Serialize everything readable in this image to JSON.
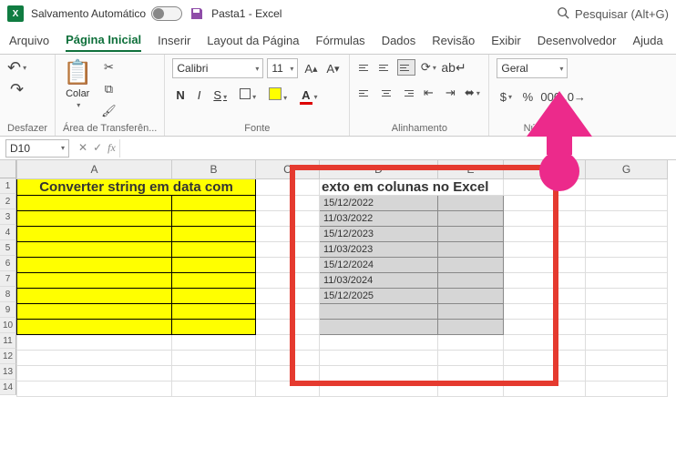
{
  "titlebar": {
    "autosave_label": "Salvamento Automático",
    "doc_title": "Pasta1 - Excel",
    "search_placeholder": "Pesquisar (Alt+G)"
  },
  "tabs": {
    "file": "Arquivo",
    "home": "Página Inicial",
    "insert": "Inserir",
    "layout": "Layout da Página",
    "formulas": "Fórmulas",
    "data": "Dados",
    "review": "Revisão",
    "view": "Exibir",
    "developer": "Desenvolvedor",
    "help": "Ajuda"
  },
  "ribbon": {
    "undo_group": "Desfazer",
    "clipboard_group": "Área de Transferên...",
    "paste_label": "Colar",
    "font_group": "Fonte",
    "font_name": "Calibri",
    "font_size": "11",
    "align_group": "Alinhamento",
    "number_group": "Número",
    "number_format": "Geral"
  },
  "namebox": {
    "ref": "D10"
  },
  "columns": [
    "A",
    "B",
    "C",
    "D",
    "E",
    "F",
    "G"
  ],
  "rows": [
    "1",
    "2",
    "3",
    "4",
    "5",
    "6",
    "7",
    "8",
    "9",
    "10",
    "11",
    "12",
    "13",
    "14"
  ],
  "sheet": {
    "title": "Converter string em data com texto em colunas no Excel",
    "title_left": "Converter string em data com",
    "title_right": "exto em colunas no Excel",
    "dates": [
      "15/12/2022",
      "11/03/2022",
      "15/12/2023",
      "11/03/2023",
      "15/12/2024",
      "11/03/2024",
      "15/12/2025"
    ]
  }
}
